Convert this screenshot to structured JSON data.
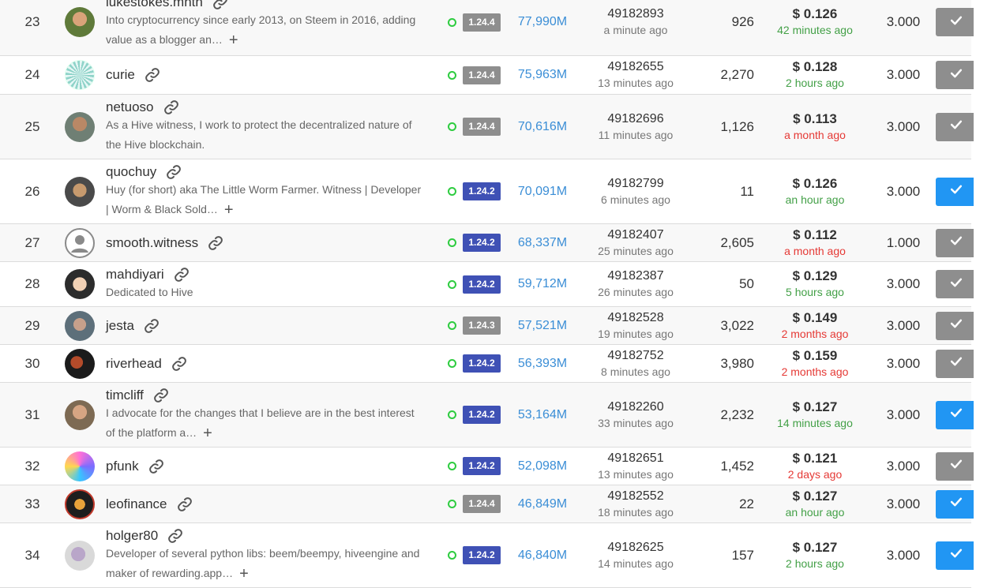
{
  "rows": [
    {
      "rank": "23",
      "name": "lukestokes.mhth",
      "desc": "Into cryptocurrency since early 2013, on Steem in 2016, adding value as a blogger an…",
      "more": true,
      "version": "1.24.4",
      "ver_style": "old",
      "votes": "77,990M",
      "block": "49182893",
      "block_ago": "a minute ago",
      "missed": "926",
      "price": "$ 0.126",
      "price_ago": "42 minutes ago",
      "price_color": "green",
      "rate": "3.000",
      "voted": false,
      "avatar": "av1",
      "height": 85
    },
    {
      "rank": "24",
      "name": "curie",
      "desc": "",
      "more": false,
      "version": "1.24.4",
      "ver_style": "old",
      "votes": "75,963M",
      "block": "49182655",
      "block_ago": "13 minutes ago",
      "missed": "2,270",
      "price": "$ 0.128",
      "price_ago": "2 hours ago",
      "price_color": "green",
      "rate": "3.000",
      "voted": false,
      "avatar": "av2",
      "height": 49
    },
    {
      "rank": "25",
      "name": "netuoso",
      "desc": "As a Hive witness, I work to protect the decentralized nature of the Hive blockchain.",
      "more": false,
      "version": "1.24.4",
      "ver_style": "old",
      "votes": "70,616M",
      "block": "49182696",
      "block_ago": "11 minutes ago",
      "missed": "1,126",
      "price": "$ 0.113",
      "price_ago": "a month ago",
      "price_color": "red",
      "rate": "3.000",
      "voted": false,
      "avatar": "av3",
      "height": 82
    },
    {
      "rank": "26",
      "name": "quochuy",
      "desc": "Huy (for short) aka The Little Worm Farmer. Witness | Developer | Worm & Black Sold…",
      "more": true,
      "version": "1.24.2",
      "ver_style": "new",
      "votes": "70,091M",
      "block": "49182799",
      "block_ago": "6 minutes ago",
      "missed": "11",
      "price": "$ 0.126",
      "price_ago": "an hour ago",
      "price_color": "green",
      "rate": "3.000",
      "voted": true,
      "avatar": "av4",
      "height": 82
    },
    {
      "rank": "27",
      "name": "smooth.witness",
      "desc": "",
      "more": false,
      "version": "1.24.2",
      "ver_style": "new",
      "votes": "68,337M",
      "block": "49182407",
      "block_ago": "25 minutes ago",
      "missed": "2,605",
      "price": "$ 0.112",
      "price_ago": "a month ago",
      "price_color": "red",
      "rate": "1.000",
      "voted": false,
      "avatar": "av5",
      "height": 48
    },
    {
      "rank": "28",
      "name": "mahdiyari",
      "desc": "Dedicated to Hive",
      "more": false,
      "version": "1.24.2",
      "ver_style": "new",
      "votes": "59,712M",
      "block": "49182387",
      "block_ago": "26 minutes ago",
      "missed": "50",
      "price": "$ 0.129",
      "price_ago": "5 hours ago",
      "price_color": "green",
      "rate": "3.000",
      "voted": false,
      "avatar": "av6",
      "height": 57
    },
    {
      "rank": "29",
      "name": "jesta",
      "desc": "",
      "more": false,
      "version": "1.24.3",
      "ver_style": "old",
      "votes": "57,521M",
      "block": "49182528",
      "block_ago": "19 minutes ago",
      "missed": "3,022",
      "price": "$ 0.149",
      "price_ago": "2 months ago",
      "price_color": "red",
      "rate": "3.000",
      "voted": false,
      "avatar": "av7",
      "height": 48
    },
    {
      "rank": "30",
      "name": "riverhead",
      "desc": "",
      "more": false,
      "version": "1.24.2",
      "ver_style": "new",
      "votes": "56,393M",
      "block": "49182752",
      "block_ago": "8 minutes ago",
      "missed": "3,980",
      "price": "$ 0.159",
      "price_ago": "2 months ago",
      "price_color": "red",
      "rate": "3.000",
      "voted": false,
      "avatar": "av8",
      "height": 48
    },
    {
      "rank": "31",
      "name": "timcliff",
      "desc": "I advocate for the changes that I believe are in the best interest of the platform a…",
      "more": true,
      "version": "1.24.2",
      "ver_style": "new",
      "votes": "53,164M",
      "block": "49182260",
      "block_ago": "33 minutes ago",
      "missed": "2,232",
      "price": "$ 0.127",
      "price_ago": "14 minutes ago",
      "price_color": "green",
      "rate": "3.000",
      "voted": true,
      "avatar": "av9",
      "height": 82
    },
    {
      "rank": "32",
      "name": "pfunk",
      "desc": "",
      "more": false,
      "version": "1.24.2",
      "ver_style": "new",
      "votes": "52,098M",
      "block": "49182651",
      "block_ago": "13 minutes ago",
      "missed": "1,452",
      "price": "$ 0.121",
      "price_ago": "2 days ago",
      "price_color": "red",
      "rate": "3.000",
      "voted": false,
      "avatar": "av10",
      "height": 48
    },
    {
      "rank": "33",
      "name": "leofinance",
      "desc": "",
      "more": false,
      "version": "1.24.4",
      "ver_style": "old",
      "votes": "46,849M",
      "block": "49182552",
      "block_ago": "18 minutes ago",
      "missed": "22",
      "price": "$ 0.127",
      "price_ago": "an hour ago",
      "price_color": "green",
      "rate": "3.000",
      "voted": true,
      "avatar": "av11",
      "height": 48
    },
    {
      "rank": "34",
      "name": "holger80",
      "desc": "Developer of several python libs: beem/beempy, hiveengine and maker of rewarding.app…",
      "more": true,
      "version": "1.24.2",
      "ver_style": "new",
      "votes": "46,840M",
      "block": "49182625",
      "block_ago": "14 minutes ago",
      "missed": "157",
      "price": "$ 0.127",
      "price_ago": "2 hours ago",
      "price_color": "green",
      "rate": "3.000",
      "voted": true,
      "avatar": "av12",
      "height": 82
    }
  ],
  "icons": {
    "link": "link-icon",
    "check": "check-icon",
    "more": "plus-icon"
  },
  "colors": {
    "vote_on": "#2196f3",
    "vote_off": "#8e8e8e",
    "version_new": "#3f51b5",
    "version_old": "#8e8e8e",
    "votes_link": "#3b8ed6",
    "ago_green": "#43a047",
    "ago_red": "#e53935"
  }
}
